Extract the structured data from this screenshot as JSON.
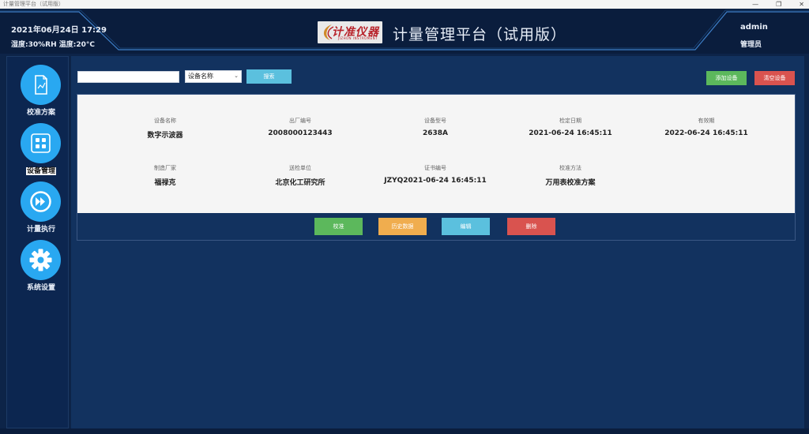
{
  "os": {
    "window_title": "计量管理平台（试用版）",
    "minimize": "—",
    "maximize": "❐",
    "close": "✕"
  },
  "header": {
    "datetime": "2021年06月24日 17:29",
    "environment": "湿度:30%RH 温度:20°C",
    "logo_text": "计准仪器",
    "logo_subtext": "JIZHUN INSTRUMENT",
    "title": "计量管理平台（试用版）",
    "user_name": "admin",
    "user_role": "管理员"
  },
  "sidebar": {
    "items": [
      {
        "label": "校准方案",
        "icon": "calibration-doc-icon",
        "active": false
      },
      {
        "label": "设备管理",
        "icon": "grid-icon",
        "active": true
      },
      {
        "label": "计量执行",
        "icon": "fast-forward-icon",
        "active": false
      },
      {
        "label": "系统设置",
        "icon": "gear-icon",
        "active": false
      }
    ]
  },
  "toolbar": {
    "search_value": "",
    "search_placeholder": "",
    "field_select": "设备名称",
    "search_label": "搜索",
    "add_label": "添加设备",
    "clear_label": "清空设备"
  },
  "device": {
    "row1": [
      {
        "label": "设备名称",
        "value": "数字示波器"
      },
      {
        "label": "出厂编号",
        "value": "2008000123443"
      },
      {
        "label": "设备型号",
        "value": "2638A"
      },
      {
        "label": "检定日期",
        "value": "2021-06-24 16:45:11"
      },
      {
        "label": "有效期",
        "value": "2022-06-24 16:45:11"
      }
    ],
    "row2": [
      {
        "label": "制造厂家",
        "value": "福禄克"
      },
      {
        "label": "送检单位",
        "value": "北京化工研究所"
      },
      {
        "label": "证书编号",
        "value": "JZYQ2021-06-24 16:45:11"
      },
      {
        "label": "校准方法",
        "value": "万用表校准方案"
      }
    ]
  },
  "actions": {
    "calibrate": "校准",
    "history": "历史数据",
    "edit": "编辑",
    "delete": "删除"
  },
  "colors": {
    "background": "#0d2448",
    "accent": "#29a8f1",
    "success": "#5cb85c",
    "warning": "#f0ad4e",
    "info": "#5bc0de",
    "danger": "#d9534f"
  }
}
